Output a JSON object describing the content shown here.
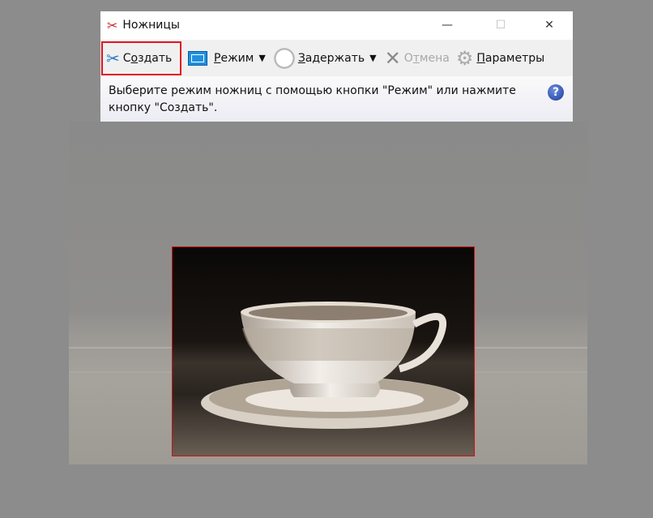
{
  "window": {
    "title": "Ножницы",
    "minimize": "—",
    "maximize": "☐",
    "close": "✕"
  },
  "toolbar": {
    "new_prefix": "С",
    "new_u": "о",
    "new_rest": "здать",
    "mode_u": "Р",
    "mode_rest": "ежим",
    "delay_u": "З",
    "delay_rest": "адержать",
    "cancel_prefix": "О",
    "cancel_u": "т",
    "cancel_rest": "мена",
    "options_u": "П",
    "options_rest": "араметры",
    "dropdown": "▼"
  },
  "message": {
    "text": "Выберите режим ножниц с помощью кнопки \"Режим\" или нажмите кнопку \"Создать\".",
    "help": "?"
  },
  "colors": {
    "accent": "#e0141e",
    "selection_border": "#d01010"
  }
}
